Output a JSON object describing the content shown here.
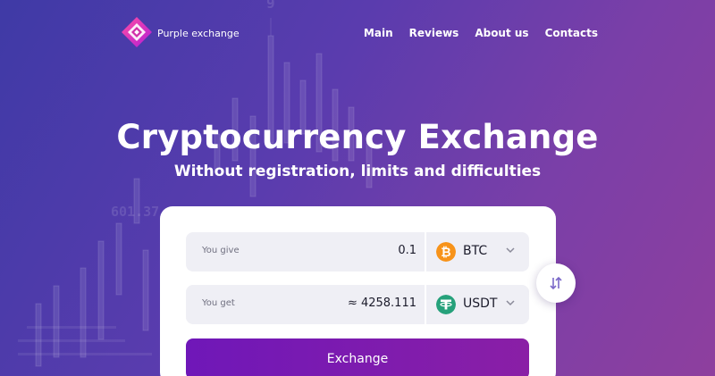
{
  "brand": {
    "name": "Purple exchange"
  },
  "nav": {
    "items": [
      "Main",
      "Reviews",
      "About us",
      "Contacts"
    ]
  },
  "hero": {
    "title": "Cryptocurrency Exchange",
    "subtitle": "Without registration, limits and difficulties"
  },
  "background": {
    "numbers": [
      "601.37",
      "9"
    ]
  },
  "form": {
    "give": {
      "label": "You give",
      "amount": "0.1",
      "currency": "BTC",
      "icon": "bitcoin-icon",
      "color": "#f7931a"
    },
    "get": {
      "label": "You get",
      "amount": "≈ 4258.111",
      "currency": "USDT",
      "icon": "tether-icon",
      "color": "#26a17b"
    },
    "swap_icon": "swap-arrows-icon",
    "submit_label": "Exchange"
  },
  "colors": {
    "accent": "#7a1ab4",
    "background_start": "#3f3aa6",
    "background_end": "#8e3f9e"
  }
}
